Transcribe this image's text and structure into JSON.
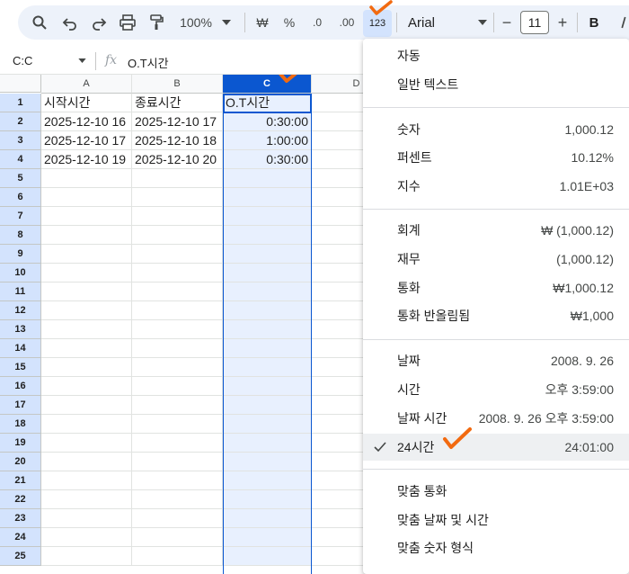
{
  "toolbar": {
    "zoom": "100%",
    "currency_symbol": "₩",
    "percent_symbol": "%",
    "decrease_decimal": ".0",
    "increase_decimal": ".00",
    "format_more": "123",
    "font": "Arial",
    "font_size": "11",
    "bold": "B",
    "minus": "−",
    "plus": "+"
  },
  "formula_bar": {
    "name_box": "C:C",
    "fx": "fx",
    "formula": "O.T시간"
  },
  "columns": [
    "A",
    "B",
    "C",
    "D"
  ],
  "rows": [
    "1",
    "2",
    "3",
    "4",
    "5",
    "6",
    "7",
    "8",
    "9",
    "10",
    "11",
    "12",
    "13",
    "14",
    "15",
    "16",
    "17",
    "18",
    "19",
    "20",
    "21",
    "22",
    "23",
    "24",
    "25"
  ],
  "cells": [
    [
      "시작시간",
      "종료시간",
      "O.T시간"
    ],
    [
      "2025-12-10 16",
      "2025-12-10 17",
      "0:30:00"
    ],
    [
      "2025-12-10 17",
      "2025-12-10 18",
      "1:00:00"
    ],
    [
      "2025-12-10 19",
      "2025-12-10 20",
      "0:30:00"
    ]
  ],
  "format_menu": {
    "items": [
      {
        "label": "자동",
        "example": ""
      },
      {
        "label": "일반 텍스트",
        "example": ""
      },
      {
        "label": "숫자",
        "example": "1,000.12"
      },
      {
        "label": "퍼센트",
        "example": "10.12%"
      },
      {
        "label": "지수",
        "example": "1.01E+03"
      },
      {
        "label": "회계",
        "example": "₩ (1,000.12)"
      },
      {
        "label": "재무",
        "example": "(1,000.12)"
      },
      {
        "label": "통화",
        "example": "₩1,000.12"
      },
      {
        "label": "통화 반올림됨",
        "example": "₩1,000"
      },
      {
        "label": "날짜",
        "example": "2008. 9. 26"
      },
      {
        "label": "시간",
        "example": "오후 3:59:00"
      },
      {
        "label": "날짜 시간",
        "example": "2008. 9. 26 오후 3:59:00"
      },
      {
        "label": "24시간",
        "example": "24:01:00"
      },
      {
        "label": "맞춤 통화",
        "example": ""
      },
      {
        "label": "맞춤 날짜 및 시간",
        "example": ""
      },
      {
        "label": "맞춤 숫자 형식",
        "example": ""
      }
    ],
    "checked_item": "24시간"
  },
  "colors": {
    "accent": "#0b57d0",
    "selection": "#e8f0fe",
    "annotation": "#f26a10"
  }
}
